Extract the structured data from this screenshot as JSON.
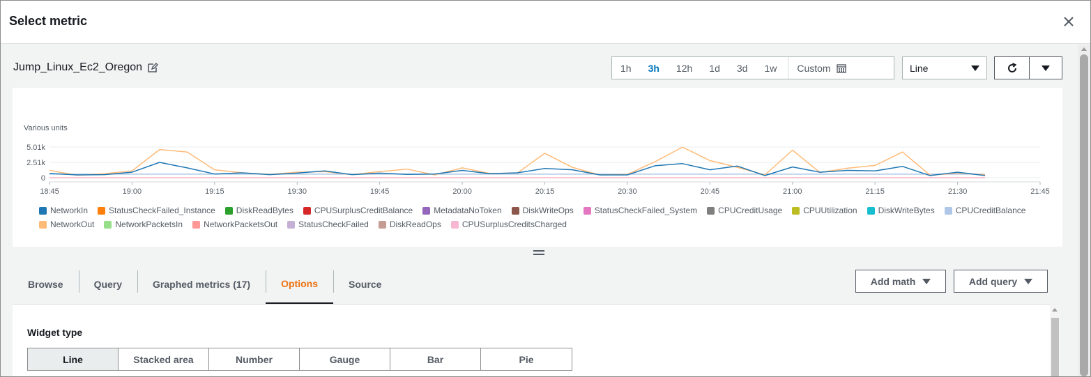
{
  "modal": {
    "title": "Select metric",
    "close_icon": "close-icon"
  },
  "graph": {
    "name": "Jump_Linux_Ec2_Oregon",
    "edit_icon": "edit-icon"
  },
  "time_range": {
    "options": [
      "1h",
      "3h",
      "12h",
      "1d",
      "3d",
      "1w"
    ],
    "selected": "3h",
    "custom_label": "Custom",
    "custom_icon": "calendar-icon"
  },
  "chart_type_select": {
    "value": "Line"
  },
  "refresh": {
    "icon": "refresh-icon",
    "dropdown_icon": "caret-down-icon"
  },
  "tabs": [
    {
      "label": "Browse"
    },
    {
      "label": "Query"
    },
    {
      "label": "Graphed metrics (17)"
    },
    {
      "label": "Options",
      "active": true
    },
    {
      "label": "Source"
    }
  ],
  "actions": {
    "add_math": "Add math",
    "add_query": "Add query"
  },
  "options_panel": {
    "widget_type_title": "Widget type",
    "widget_types": [
      "Line",
      "Stacked area",
      "Number",
      "Gauge",
      "Bar",
      "Pie"
    ],
    "selected_widget_type": "Line"
  },
  "chart_data": {
    "type": "line",
    "ylabel": "Various units",
    "yticks": [
      "0",
      "2.51k",
      "5.01k"
    ],
    "ylim": [
      0,
      5010
    ],
    "xticks": [
      "18:45",
      "19:00",
      "19:15",
      "19:30",
      "19:45",
      "20:00",
      "20:15",
      "20:30",
      "20:45",
      "21:00",
      "21:15",
      "21:30",
      "21:45"
    ],
    "x": [
      "18:45",
      "18:50",
      "18:55",
      "19:00",
      "19:05",
      "19:10",
      "19:15",
      "19:20",
      "19:25",
      "19:30",
      "19:35",
      "19:40",
      "19:45",
      "19:50",
      "19:55",
      "20:00",
      "20:05",
      "20:10",
      "20:15",
      "20:20",
      "20:25",
      "20:30",
      "20:35",
      "20:40",
      "20:45",
      "20:50",
      "20:55",
      "21:00",
      "21:05",
      "21:10",
      "21:15",
      "21:20",
      "21:25",
      "21:30",
      "21:35"
    ],
    "grid": true,
    "legend_position": "bottom",
    "series": [
      {
        "name": "NetworkIn",
        "color": "#1f77b4",
        "values": [
          700,
          450,
          500,
          900,
          2500,
          1600,
          600,
          800,
          500,
          750,
          1100,
          500,
          750,
          550,
          600,
          1200,
          650,
          800,
          1500,
          1300,
          450,
          450,
          1950,
          2300,
          1300,
          1900,
          350,
          1750,
          900,
          1200,
          1100,
          1850,
          350,
          900,
          350
        ]
      },
      {
        "name": "StatusCheckFailed_Instance",
        "color": "#ff7f0e",
        "values": []
      },
      {
        "name": "DiskReadBytes",
        "color": "#2ca02c",
        "values": []
      },
      {
        "name": "CPUSurplusCreditBalance",
        "color": "#d62728",
        "values": []
      },
      {
        "name": "MetadataNoToken",
        "color": "#9467bd",
        "values": []
      },
      {
        "name": "DiskWriteOps",
        "color": "#8c564b",
        "values": []
      },
      {
        "name": "StatusCheckFailed_System",
        "color": "#e377c2",
        "values": []
      },
      {
        "name": "CPUCreditUsage",
        "color": "#7f7f7f",
        "values": []
      },
      {
        "name": "CPUUtilization",
        "color": "#bcbd22",
        "values": []
      },
      {
        "name": "DiskWriteBytes",
        "color": "#17becf",
        "values": []
      },
      {
        "name": "CPUCreditBalance",
        "color": "#aec7e8",
        "values": [
          576,
          576,
          576,
          576,
          576,
          576,
          576,
          576,
          576,
          576,
          576,
          576,
          576,
          576,
          576,
          576,
          576,
          576,
          576,
          576,
          576,
          576,
          576,
          576,
          576,
          576,
          576,
          576,
          576,
          576,
          576,
          576,
          576,
          576,
          576
        ]
      },
      {
        "name": "NetworkOut",
        "color": "#ffbb78",
        "values": [
          1200,
          400,
          650,
          1100,
          4600,
          4200,
          1300,
          800,
          550,
          900,
          1000,
          500,
          1000,
          1400,
          450,
          1600,
          700,
          750,
          4000,
          1700,
          450,
          550,
          2600,
          5000,
          2800,
          1700,
          450,
          4500,
          850,
          1550,
          2000,
          4200,
          400,
          750,
          500
        ]
      },
      {
        "name": "NetworkPacketsIn",
        "color": "#98df8a",
        "values": []
      },
      {
        "name": "NetworkPacketsOut",
        "color": "#ff9896",
        "values": []
      },
      {
        "name": "StatusCheckFailed",
        "color": "#c5b0d5",
        "values": []
      },
      {
        "name": "DiskReadOps",
        "color": "#c49c94",
        "values": []
      },
      {
        "name": "CPUSurplusCreditsCharged",
        "color": "#f7b6d2",
        "values": []
      }
    ]
  }
}
